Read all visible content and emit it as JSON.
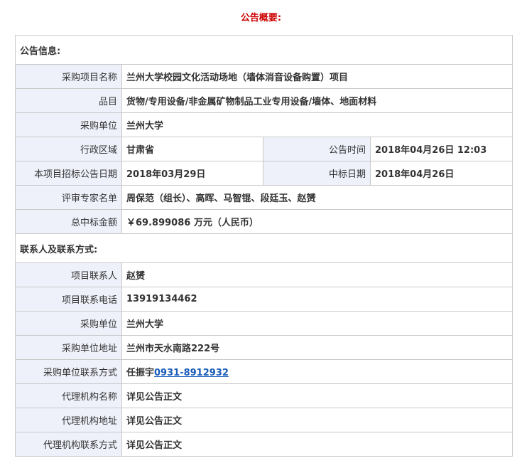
{
  "title": "公告概要:",
  "sections": {
    "info_header": "公告信息:",
    "contact_header": "联系人及联系方式:"
  },
  "info": {
    "project_name_label": "采购项目名称",
    "project_name": "兰州大学校园文化活动场地（墙体消音设备购置）项目",
    "category_label": "品目",
    "category": "货物/专用设备/非金属矿物制品工业专用设备/墙体、地面材料",
    "purchaser_label": "采购单位",
    "purchaser": "兰州大学",
    "region_label": "行政区域",
    "region": "甘肃省",
    "publish_time_label": "公告时间",
    "publish_time": "2018年04月26日 12:03",
    "tender_date_label": "本项目招标公告日期",
    "tender_date": "2018年03月29日",
    "award_date_label": "中标日期",
    "award_date": "2018年04月26日",
    "experts_label": "评审专家名单",
    "experts": "周保范（组长）、高晖、马智锟、段廷玉、赵赟",
    "total_amount_label": "总中标金额",
    "total_amount": "￥69.899086 万元（人民币）"
  },
  "contact": {
    "project_contact_label": "项目联系人",
    "project_contact": "赵赟",
    "project_phone_label": "项目联系电话",
    "project_phone": "13919134462",
    "purchaser_label": "采购单位",
    "purchaser": "兰州大学",
    "purchaser_address_label": "采购单位地址",
    "purchaser_address": "兰州市天水南路222号",
    "purchaser_contact_label": "采购单位联系方式",
    "purchaser_contact_name": "任振宇",
    "purchaser_contact_phone": "0931-8912932",
    "agency_name_label": "代理机构名称",
    "agency_name": "详见公告正文",
    "agency_address_label": "代理机构地址",
    "agency_address": "详见公告正文",
    "agency_contact_label": "代理机构联系方式",
    "agency_contact": "详见公告正文"
  }
}
